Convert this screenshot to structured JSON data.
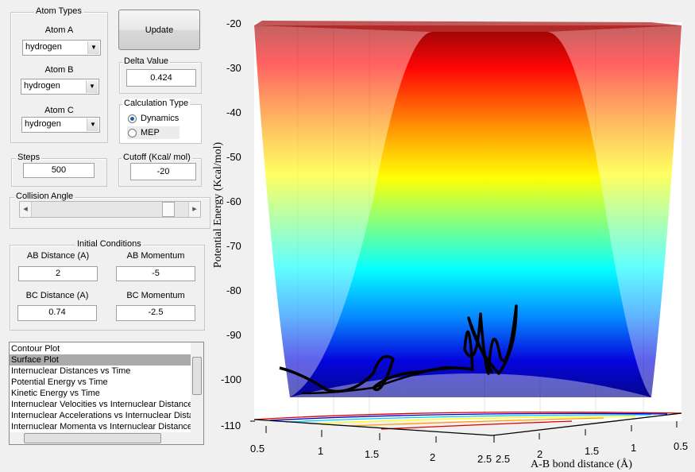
{
  "atom_types": {
    "title": "Atom Types",
    "atom_a": {
      "label": "Atom A",
      "value": "hydrogen"
    },
    "atom_b": {
      "label": "Atom B",
      "value": "hydrogen"
    },
    "atom_c": {
      "label": "Atom C",
      "value": "hydrogen"
    }
  },
  "update_label": "Update",
  "delta": {
    "title": "Delta Value",
    "value": "0.424"
  },
  "calc": {
    "title": "Calculation Type",
    "options": [
      "Dynamics",
      "MEP"
    ],
    "selected": "Dynamics"
  },
  "steps": {
    "title": "Steps",
    "value": "500"
  },
  "cutoff": {
    "title": "Cutoff (Kcal/ mol)",
    "value": "-20"
  },
  "collision": {
    "title": "Collision Angle",
    "arrow_left": "◂",
    "arrow_right": "▸",
    "position": 0.85
  },
  "initial": {
    "title": "Initial Conditions",
    "ab_dist_label": "AB Distance (A)",
    "ab_dist": "2",
    "ab_mom_label": "AB Momentum",
    "ab_mom": "-5",
    "bc_dist_label": "BC Distance (A)",
    "bc_dist": "0.74",
    "bc_mom_label": "BC Momentum",
    "bc_mom": "-2.5"
  },
  "plot_list": {
    "items": [
      "Contour Plot",
      "Surface Plot",
      "Internuclear Distances vs Time",
      "Potential Energy vs Time",
      "Kinetic Energy vs Time",
      "Internuclear Velocities vs Internuclear Distance",
      "Internuclear Accelerations vs Internuclear Distance",
      "Internuclear Momenta vs Internuclear Distance"
    ],
    "selected": "Surface Plot"
  },
  "chart_data": {
    "type": "surface",
    "zlabel": "Potential Energy (Kcal/mol)",
    "xlabel": "A-B bond distance (Å)",
    "zticks": [
      "-20",
      "-30",
      "-40",
      "-50",
      "-60",
      "-70",
      "-80",
      "-90",
      "-100",
      "-110"
    ],
    "zlim": [
      -110,
      -20
    ],
    "xticks_left": [
      "0.5",
      "1",
      "1.5",
      "2",
      "2.5"
    ],
    "xticks_right": [
      "2.5",
      "2",
      "1.5",
      "1",
      "0.5"
    ],
    "colormap": "jet"
  }
}
